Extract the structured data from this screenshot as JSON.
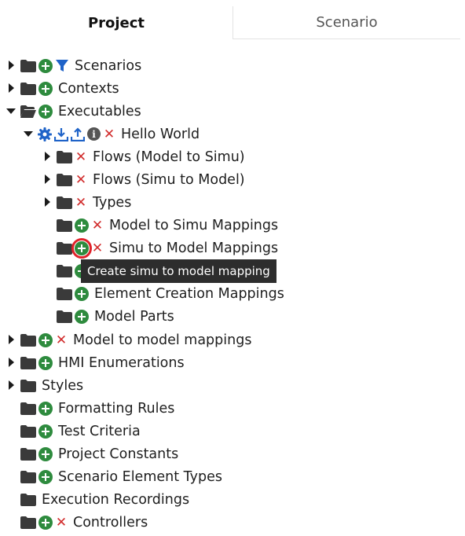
{
  "tabs": {
    "project": "Project",
    "scenario": "Scenario"
  },
  "tree": {
    "scenarios": "Scenarios",
    "contexts": "Contexts",
    "executables": "Executables",
    "hello_world": "Hello World",
    "flows_m2s": "Flows (Model to Simu)",
    "flows_s2m": "Flows (Simu to Model)",
    "types": "Types",
    "m2s_mappings": "Model to Simu Mappings",
    "s2m_mappings": "Simu to Model Mappings",
    "element_creation": "Element Creation Mappings",
    "model_parts": "Model Parts",
    "m2m_mappings": "Model to model mappings",
    "hmi_enums": "HMI Enumerations",
    "styles": "Styles",
    "formatting_rules": "Formatting Rules",
    "test_criteria": "Test Criteria",
    "project_constants": "Project Constants",
    "scenario_element_types": "Scenario Element Types",
    "execution_recordings": "Execution Recordings",
    "controllers": "Controllers"
  },
  "tooltip": "Create simu to model mapping",
  "colors": {
    "add": "#2e8b3e",
    "delete": "#d12b2b",
    "accent": "#1f63c8",
    "folder": "#3a3a3a"
  },
  "icons": [
    "caret-right",
    "caret-down",
    "folder",
    "folder-open",
    "plus-circle",
    "filter",
    "gear",
    "download",
    "upload",
    "info",
    "close"
  ]
}
